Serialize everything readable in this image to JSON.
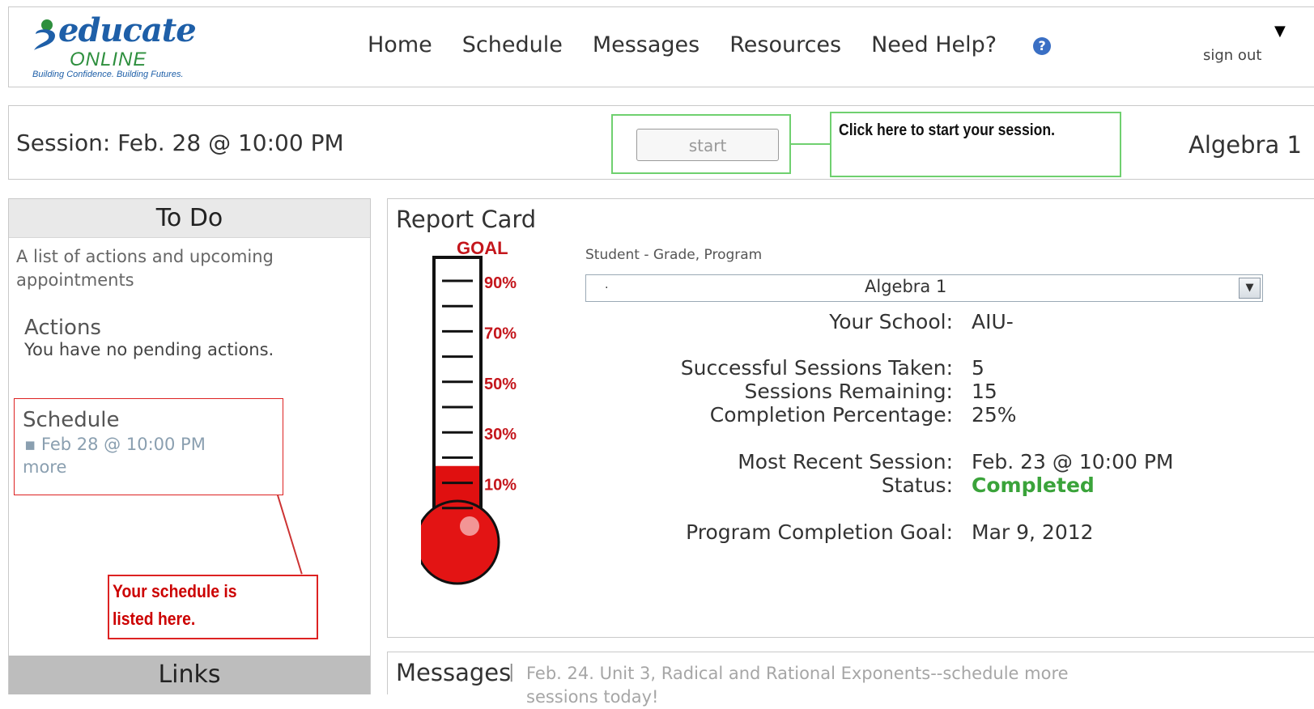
{
  "logo": {
    "word": "educate",
    "online": "ONLINE",
    "tagline": "Building Confidence. Building Futures."
  },
  "nav": {
    "items": [
      "Home",
      "Schedule",
      "Messages",
      "Resources",
      "Need Help?"
    ],
    "help_icon": "question-circle-icon"
  },
  "header": {
    "sign_out": "sign out",
    "menu_icon": "▼"
  },
  "session": {
    "label": "Session: Feb. 28 @ 10:00 PM",
    "start_button": "start",
    "start_note": "Click here to start your session.",
    "subject": "Algebra 1"
  },
  "todo": {
    "title": "To Do",
    "description": "A list of actions and upcoming appointments",
    "actions_title": "Actions",
    "actions_text": "You have no pending actions.",
    "schedule_title": "Schedule",
    "schedule_item": "Feb 28 @ 10:00 PM",
    "schedule_more": "more",
    "schedule_note": "Your schedule is listed here."
  },
  "links": {
    "title": "Links"
  },
  "report": {
    "title": "Report Card",
    "goal_label": "GOAL",
    "progress_fraction": 0.25,
    "thermometer_ticks": [
      "90%",
      "70%",
      "50%",
      "30%",
      "10%"
    ],
    "field_label": "Student - Grade, Program",
    "select_value": "Algebra 1",
    "select_prefix": ".",
    "rows": {
      "school": {
        "label": "Your School:",
        "value": "AIU-"
      },
      "sessions_taken": {
        "label": "Successful Sessions Taken:",
        "value": "5"
      },
      "sessions_remaining": {
        "label": "Sessions Remaining:",
        "value": "15"
      },
      "completion_pct": {
        "label": "Completion Percentage:",
        "value": "25%"
      },
      "recent_session": {
        "label": "Most Recent Session:",
        "value": "Feb. 23 @ 10:00 PM"
      },
      "status": {
        "label": "Status:",
        "value": "Completed"
      },
      "goal_date": {
        "label": "Program Completion Goal:",
        "value": "Mar 9, 2012"
      }
    }
  },
  "messages": {
    "title": "Messages",
    "separator": "|",
    "text": "Feb. 24. Unit 3, Radical and Rational Exponents--schedule more sessions today!"
  },
  "colors": {
    "brand_blue": "#1e5fa8",
    "brand_green": "#2e8f3e",
    "annotation_green": "#6fd06f",
    "annotation_red": "#d22222",
    "status_green": "#3aa33a",
    "thermo_red": "#e01010"
  }
}
